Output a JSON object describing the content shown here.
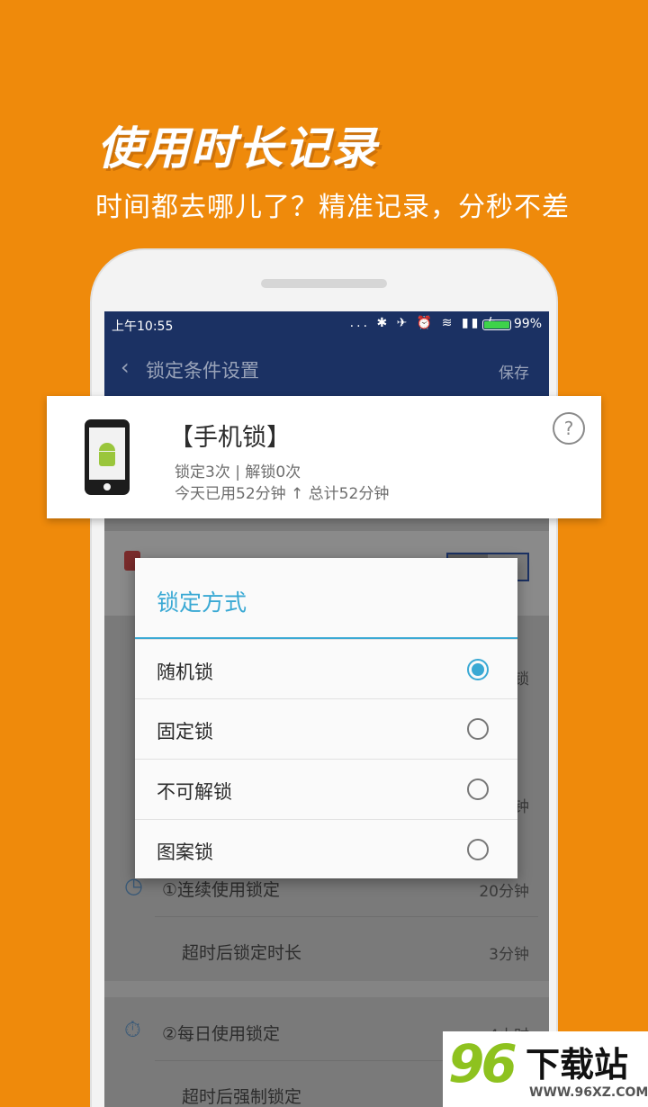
{
  "promo": {
    "title": "使用时长记录",
    "subtitle": "时间都去哪儿了？精准记录，分秒不差"
  },
  "status_bar": {
    "time": "上午10:55",
    "icons": "... ✱ ✈ ⏰ ≋ ▮▮ ϟ",
    "battery_percent": "99%",
    "battery_level": 0.99
  },
  "nav": {
    "back_icon": "‹",
    "title": "锁定条件设置",
    "save_label": "保存"
  },
  "card": {
    "title": "【手机锁】",
    "stats": "锁定3次 | 解锁0次",
    "usage": "今天已用52分钟 ↑ 总计52分钟",
    "help": "?"
  },
  "dialog": {
    "title": "锁定方式",
    "options": [
      {
        "label": "随机锁",
        "selected": true
      },
      {
        "label": "固定锁",
        "selected": false
      },
      {
        "label": "不可解锁",
        "selected": false
      },
      {
        "label": "图案锁",
        "selected": false
      }
    ]
  },
  "background_list": {
    "row1_label": "①连续使用锁定",
    "row1_value": "20分钟",
    "row2_label": "超时后锁定时长",
    "row2_value": "3分钟",
    "row3_label": "②每日使用锁定",
    "row3_value": "4小时",
    "row4_label": "超时后强制锁定",
    "peek_right_1": "锁",
    "peek_right_2": "钟"
  },
  "logo": {
    "number": "96",
    "text": "下载站",
    "domain": "WWW.96XZ.COM"
  }
}
